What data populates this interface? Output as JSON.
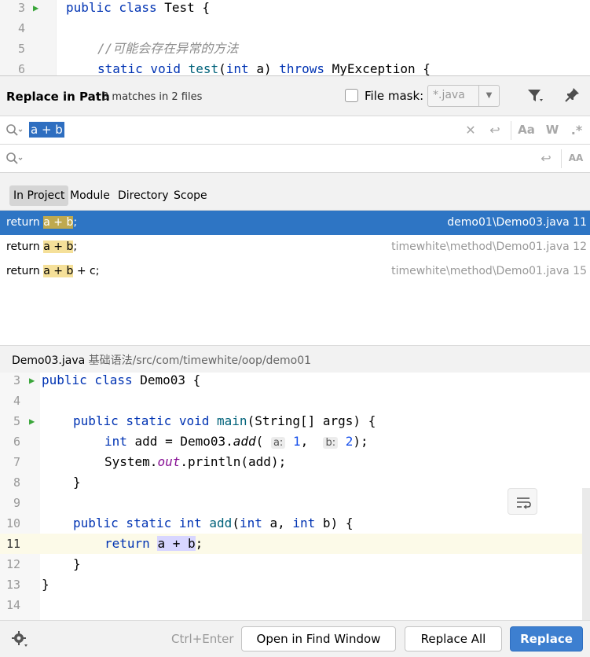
{
  "background_editor": {
    "lines": [
      {
        "number": "3",
        "code": "public class Test {"
      },
      {
        "number": "4",
        "code": ""
      },
      {
        "number": "5",
        "code": "    //可能会存在异常的方法"
      },
      {
        "number": "6",
        "code": "    static void test(int a) throws MyException {"
      }
    ]
  },
  "dialog": {
    "title": "Replace in Path",
    "subtitle": "3 matches in 2 files",
    "file_mask": {
      "label": "File mask:",
      "value": "*.java",
      "checked": false
    },
    "search": {
      "value": "a + b",
      "case_label": "Aa",
      "words_label": "W",
      "regex_label": ".*"
    },
    "replace": {
      "value": "",
      "preserve_case_label": "AA"
    },
    "scope_tabs": [
      {
        "label": "In Project",
        "active": true
      },
      {
        "label": "Module"
      },
      {
        "label": "Directory"
      },
      {
        "label": "Scope"
      }
    ],
    "results": [
      {
        "prefix": "return ",
        "match": "a + b",
        "suffix": ";",
        "path": "demo01\\Demo03.java 11",
        "selected": true
      },
      {
        "prefix": "return ",
        "match": "a + b",
        "suffix": ";",
        "path": "timewhite\\method\\Demo01.java 12"
      },
      {
        "prefix": "return ",
        "match": "a + b",
        "suffix": " + c;",
        "path": "timewhite\\method\\Demo01.java 15"
      }
    ],
    "preview": {
      "file": "Demo03.java",
      "path": "基础语法/src/com/timewhite/oop/demo01",
      "line_numbers": [
        "3",
        "4",
        "5",
        "6",
        "7",
        "8",
        "9",
        "10",
        "11",
        "12",
        "13",
        "14"
      ],
      "hint_a": "a:",
      "hint_b": "b:"
    },
    "footer": {
      "shortcut": "Ctrl+Enter",
      "open_find_window": "Open in Find Window",
      "replace_all": "Replace All",
      "replace": "Replace"
    }
  },
  "colors": {
    "accent": "#2e75c4",
    "match_highlight": "#f5e099",
    "primary_button": "#3d7fd0"
  }
}
